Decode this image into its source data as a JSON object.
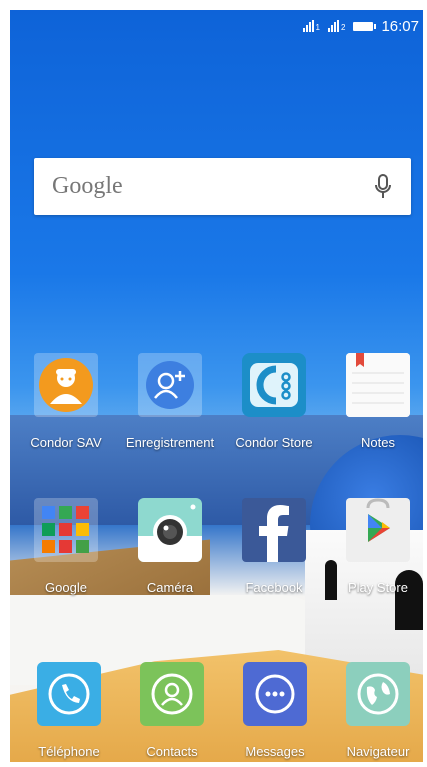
{
  "status_bar": {
    "sim1": "1",
    "sim2": "2",
    "time": "16:07"
  },
  "search": {
    "label": "Google"
  },
  "rows": [
    [
      {
        "label": "Condor SAV",
        "icon": "technician-icon"
      },
      {
        "label": "Enregistrement",
        "icon": "add-user-icon"
      },
      {
        "label": "Condor Store",
        "icon": "condor-store-icon"
      },
      {
        "label": "Notes",
        "icon": "notepad-icon"
      }
    ],
    [
      {
        "label": "Google",
        "icon": "google-folder-icon"
      },
      {
        "label": "Caméra",
        "icon": "camera-icon"
      },
      {
        "label": "Facebook",
        "icon": "facebook-icon"
      },
      {
        "label": "Play Store",
        "icon": "play-store-icon"
      }
    ]
  ],
  "dock": [
    {
      "label": "Téléphone",
      "icon": "phone-icon"
    },
    {
      "label": "Contacts",
      "icon": "contact-icon"
    },
    {
      "label": "Messages",
      "icon": "message-icon"
    },
    {
      "label": "Navigateur",
      "icon": "globe-icon"
    }
  ],
  "colors": {
    "sav": "#f39a1e",
    "enregistrement": "#3d7fe0",
    "condor_store": "#1c8ec8",
    "camera": "#8ed9cf",
    "facebook": "#3b5998",
    "dock_phone": "#3aaee5",
    "dock_contacts": "#7cc35a",
    "dock_messages": "#4e6ad3",
    "dock_browser": "#8ccfbd"
  }
}
